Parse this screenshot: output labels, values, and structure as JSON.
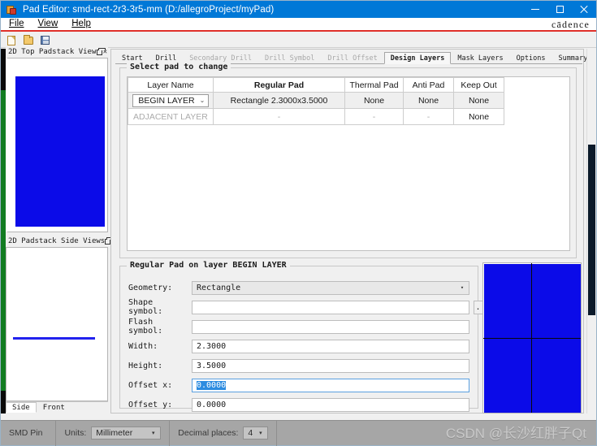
{
  "window": {
    "title": "Pad Editor: smd-rect-2r3-3r5-mm  (D:/allegroProject/myPad)",
    "app_icon": "pad-editor-icon",
    "minimize": "–",
    "maximize": "□",
    "close": "✕",
    "brand": "cādence",
    "titlebar_color": "#0078d7",
    "accent_rule_color": "#e0302a"
  },
  "menubar": {
    "items": [
      {
        "label": "File",
        "mnemonic": "F"
      },
      {
        "label": "View",
        "mnemonic": "V"
      },
      {
        "label": "Help",
        "mnemonic": "H"
      }
    ]
  },
  "toolbar": {
    "buttons": [
      {
        "icon": "new-file-icon",
        "tooltip": "New"
      },
      {
        "icon": "open-folder-icon",
        "tooltip": "Open"
      },
      {
        "icon": "save-disk-icon",
        "tooltip": "Save"
      }
    ]
  },
  "panels": {
    "top_view": {
      "title": "2D Top Padstack View",
      "float_icon": "float-icon",
      "close_icon": "close-icon",
      "pad_color": "#0b0be8"
    },
    "side_views": {
      "title": "2D Padstack Side Views",
      "float_icon": "float-icon",
      "close_icon": "close-icon",
      "line_color": "#2222ee",
      "tabs": [
        {
          "label": "Side",
          "active": true
        },
        {
          "label": "Front",
          "active": false
        }
      ]
    }
  },
  "main": {
    "tabs": [
      {
        "label": "Start",
        "state": "normal"
      },
      {
        "label": "Drill",
        "state": "normal"
      },
      {
        "label": "Secondary Drill",
        "state": "disabled"
      },
      {
        "label": "Drill Symbol",
        "state": "disabled"
      },
      {
        "label": "Drill Offset",
        "state": "disabled"
      },
      {
        "label": "Design Layers",
        "state": "active"
      },
      {
        "label": "Mask Layers",
        "state": "normal"
      },
      {
        "label": "Options",
        "state": "normal"
      },
      {
        "label": "Summary",
        "state": "normal"
      }
    ],
    "select_group": {
      "legend": "Select pad to change",
      "table": {
        "headers": [
          {
            "label": "Layer Name",
            "bold": false
          },
          {
            "label": "Regular Pad",
            "bold": true
          },
          {
            "label": "Thermal Pad",
            "bold": false
          },
          {
            "label": "Anti Pad",
            "bold": false
          },
          {
            "label": "Keep Out",
            "bold": false
          }
        ],
        "rows": [
          {
            "layer_name": "BEGIN LAYER",
            "layer_name_is_combo": true,
            "chevron": "⌄",
            "regular_pad": "Rectangle 2.3000x3.5000",
            "thermal_pad": "None",
            "anti_pad": "None",
            "keep_out": "None",
            "selected": true
          },
          {
            "layer_name": "ADJACENT LAYER",
            "layer_name_is_combo": false,
            "chevron": "",
            "regular_pad": "-",
            "thermal_pad": "-",
            "anti_pad": "-",
            "keep_out": "None",
            "selected": false
          }
        ]
      }
    },
    "regular_group": {
      "legend": "Regular Pad on layer BEGIN LAYER",
      "fields": [
        {
          "label": "Geometry:",
          "type": "combo",
          "value": "Rectangle",
          "chevron": "▾"
        },
        {
          "label": "Shape symbol:",
          "type": "text",
          "value": "",
          "has_browse": true,
          "browse_label": "..."
        },
        {
          "label": "Flash symbol:",
          "type": "text",
          "value": "",
          "has_browse": false
        },
        {
          "label": "Width:",
          "type": "text",
          "value": "2.3000",
          "has_browse": false
        },
        {
          "label": "Height:",
          "type": "text",
          "value": "3.5000",
          "has_browse": false
        },
        {
          "label": "Offset x:",
          "type": "text",
          "value": "0.0000",
          "has_browse": false,
          "focused": true,
          "selected_text": true
        },
        {
          "label": "Offset y:",
          "type": "text",
          "value": "0.0000",
          "has_browse": false
        }
      ]
    },
    "preview": {
      "pad_color": "#0b0be8",
      "crosshair_color": "#0a0a0a"
    }
  },
  "statusbar": {
    "pin_type": "SMD Pin",
    "units_label": "Units:",
    "units_value": "Millimeter",
    "units_chevron": "▾",
    "decimal_label": "Decimal places:",
    "decimal_value": "4",
    "decimal_chevron": "▾",
    "watermark": "CSDN @长沙红胖子Qt"
  }
}
